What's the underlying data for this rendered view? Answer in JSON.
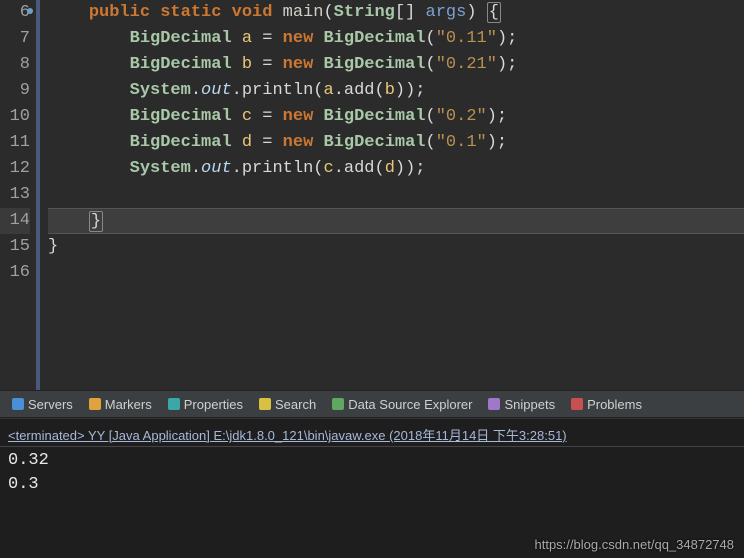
{
  "editor": {
    "lines": [
      {
        "num": "6",
        "marked": true,
        "html": "    <span class='kw'>public static void</span> <span class='method'>main</span>(<span class='type'>String</span>[] <span class='param'>args</span>) <span class='paren-hl'>{</span>"
      },
      {
        "num": "7",
        "html": "        <span class='type'>BigDecimal</span> <span class='var'>a</span> = <span class='kw'>new</span> <span class='type'>BigDecimal</span>(<span class='str'>\"0.11\"</span>);"
      },
      {
        "num": "8",
        "html": "        <span class='type'>BigDecimal</span> <span class='var'>b</span> = <span class='kw'>new</span> <span class='type'>BigDecimal</span>(<span class='str'>\"0.21\"</span>);"
      },
      {
        "num": "9",
        "html": "        <span class='type'>System</span>.<span class='field'>out</span>.println(<span class='var'>a</span>.add(<span class='var'>b</span>));"
      },
      {
        "num": "10",
        "html": "        <span class='type'>BigDecimal</span> <span class='var'>c</span> = <span class='kw'>new</span> <span class='type'>BigDecimal</span>(<span class='str'>\"0.2\"</span>);"
      },
      {
        "num": "11",
        "html": "        <span class='type'>BigDecimal</span> <span class='var'>d</span> = <span class='kw'>new</span> <span class='type'>BigDecimal</span>(<span class='str'>\"0.1\"</span>);"
      },
      {
        "num": "12",
        "html": "        <span class='type'>System</span>.<span class='field'>out</span>.println(<span class='var'>c</span>.add(<span class='var'>d</span>));"
      },
      {
        "num": "13",
        "html": ""
      },
      {
        "num": "14",
        "current": true,
        "html": "    <span class='paren-hl'>}</span>"
      },
      {
        "num": "15",
        "html": "}"
      },
      {
        "num": "16",
        "html": ""
      }
    ]
  },
  "tabs": [
    {
      "label": "Servers",
      "iconClass": "c-blue"
    },
    {
      "label": "Markers",
      "iconClass": "c-orange"
    },
    {
      "label": "Properties",
      "iconClass": "c-teal"
    },
    {
      "label": "Search",
      "iconClass": "c-yellow"
    },
    {
      "label": "Data Source Explorer",
      "iconClass": "c-green"
    },
    {
      "label": "Snippets",
      "iconClass": "c-purple"
    },
    {
      "label": "Problems",
      "iconClass": "c-red"
    }
  ],
  "console": {
    "header": "<terminated> YY [Java Application] E:\\jdk1.8.0_121\\bin\\javaw.exe (2018年11月14日 下午3:28:51)",
    "output": [
      "0.32",
      "0.3"
    ]
  },
  "watermark": "https://blog.csdn.net/qq_34872748"
}
